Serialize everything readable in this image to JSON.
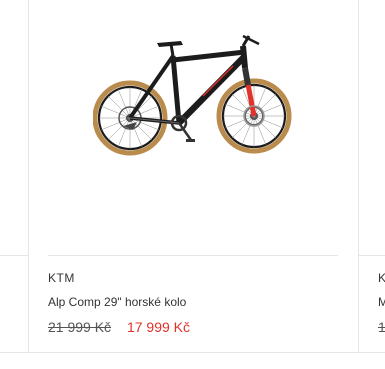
{
  "product": {
    "brand": "KTM",
    "name": "Alp Comp 29\" horské kolo",
    "old_price": "21 999 Kč",
    "new_price": "17 999 Kč",
    "image_icon": "mountain-bike-image",
    "accent_color": "#e3312b"
  },
  "next_card_peek": {
    "brand": "K",
    "name": "M",
    "price": "1"
  }
}
